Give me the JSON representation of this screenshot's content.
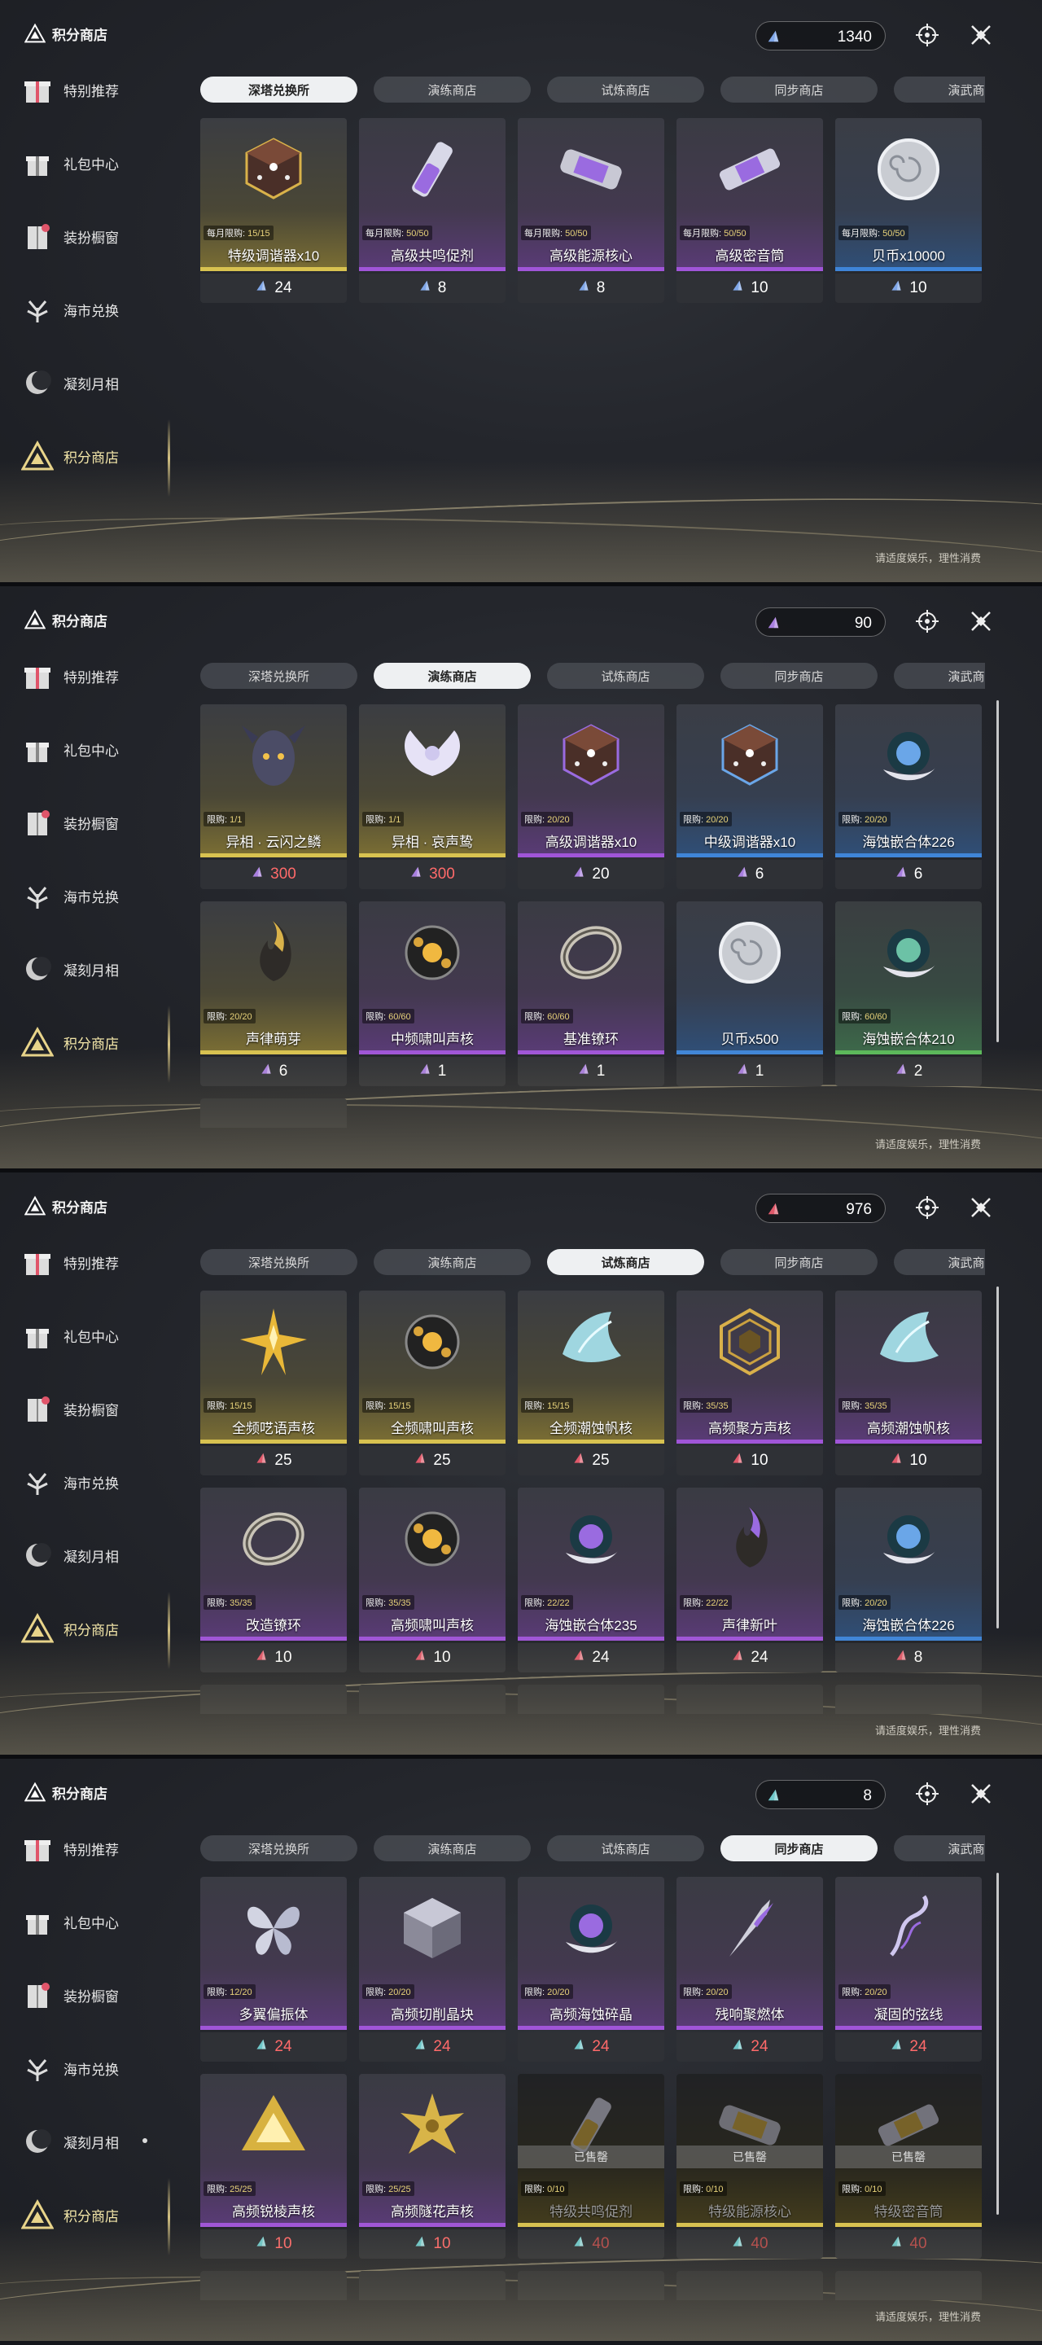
{
  "brand_title": "积分商店",
  "footnote": "请适度娱乐，理性消费",
  "sidebar": [
    {
      "label": "特别推荐",
      "icon": "gift-tag-icon"
    },
    {
      "label": "礼包中心",
      "icon": "gift-box-icon"
    },
    {
      "label": "装扮橱窗",
      "icon": "wardrobe-icon"
    },
    {
      "label": "海市兑换",
      "icon": "coral-tree-icon"
    },
    {
      "label": "凝刻月相",
      "icon": "moon-phase-icon"
    },
    {
      "label": "积分商店",
      "icon": "triangle-emblem-icon"
    }
  ],
  "tabs": [
    "深塔兑换所",
    "演练商店",
    "试炼商店",
    "同步商店",
    "演武商店"
  ],
  "panels": [
    {
      "active_tab": 0,
      "currency": {
        "value": "1340",
        "color": "#7fa6e8"
      },
      "items": [
        {
          "name": "特级调谐器x10",
          "limit_label": "每月限购:",
          "limit": "15/15",
          "price": "24",
          "rarity": "gold",
          "icon": "tuner-dice-icon"
        },
        {
          "name": "高级共鸣促剂",
          "limit_label": "每月限购:",
          "limit": "50/50",
          "price": "8",
          "rarity": "purple",
          "icon": "vial-icon"
        },
        {
          "name": "高级能源核心",
          "limit_label": "每月限购:",
          "limit": "50/50",
          "price": "8",
          "rarity": "purple",
          "icon": "energy-cell-icon"
        },
        {
          "name": "高级密音筒",
          "limit_label": "每月限购:",
          "limit": "50/50",
          "price": "10",
          "rarity": "purple",
          "icon": "sound-tube-icon"
        },
        {
          "name": "贝币x10000",
          "limit_label": "每月限购:",
          "limit": "50/50",
          "price": "10",
          "rarity": "blue",
          "icon": "shell-coin-icon"
        }
      ]
    },
    {
      "active_tab": 1,
      "currency": {
        "value": "90",
        "color": "#a97fe0"
      },
      "items": [
        {
          "name": "异相 · 云闪之鳞",
          "limit_label": "限购:",
          "limit": "1/1",
          "price": "300",
          "rarity": "gold",
          "icon": "dark-mask-icon",
          "red": true
        },
        {
          "name": "异相 · 哀声鸷",
          "limit_label": "限购:",
          "limit": "1/1",
          "price": "300",
          "rarity": "gold",
          "icon": "white-wings-icon",
          "red": true
        },
        {
          "name": "高级调谐器x10",
          "limit_label": "限购:",
          "limit": "20/20",
          "price": "20",
          "rarity": "purple",
          "icon": "tuner-dice-icon"
        },
        {
          "name": "中级调谐器x10",
          "limit_label": "限购:",
          "limit": "20/20",
          "price": "6",
          "rarity": "blue",
          "icon": "tuner-dice-icon"
        },
        {
          "name": "海蚀嵌合体226",
          "limit_label": "限购:",
          "limit": "20/20",
          "price": "6",
          "rarity": "blue",
          "icon": "orb-shell-icon"
        },
        {
          "name": "声律萌芽",
          "limit_label": "限购:",
          "limit": "20/20",
          "price": "6",
          "rarity": "gold",
          "icon": "flame-sprout-icon"
        },
        {
          "name": "中频啸叫声核",
          "limit_label": "限购:",
          "limit": "60/60",
          "price": "1",
          "rarity": "purple",
          "icon": "core-orb-icon"
        },
        {
          "name": "基准镣环",
          "limit_label": "限购:",
          "limit": "60/60",
          "price": "1",
          "rarity": "purple",
          "icon": "ring-icon"
        },
        {
          "name": "贝币x500",
          "limit_label": "",
          "limit": "",
          "price": "1",
          "rarity": "blue",
          "icon": "shell-coin-icon"
        },
        {
          "name": "海蚀嵌合体210",
          "limit_label": "限购:",
          "limit": "60/60",
          "price": "2",
          "rarity": "green",
          "icon": "orb-shell-icon"
        }
      ]
    },
    {
      "active_tab": 2,
      "currency": {
        "value": "976",
        "color": "#e0596a"
      },
      "items": [
        {
          "name": "全频呓语声核",
          "limit_label": "限购:",
          "limit": "15/15",
          "price": "25",
          "rarity": "gold",
          "icon": "star-burst-icon"
        },
        {
          "name": "全频啸叫声核",
          "limit_label": "限购:",
          "limit": "15/15",
          "price": "25",
          "rarity": "gold",
          "icon": "core-orb-icon"
        },
        {
          "name": "全频潮蚀帆核",
          "limit_label": "限购:",
          "limit": "15/15",
          "price": "25",
          "rarity": "gold",
          "icon": "crystal-sail-icon"
        },
        {
          "name": "高频聚方声核",
          "limit_label": "限购:",
          "limit": "35/35",
          "price": "10",
          "rarity": "purple",
          "icon": "hex-spiral-icon"
        },
        {
          "name": "高频潮蚀帆核",
          "limit_label": "限购:",
          "limit": "35/35",
          "price": "10",
          "rarity": "purple",
          "icon": "crystal-sail-icon"
        },
        {
          "name": "改造镣环",
          "limit_label": "限购:",
          "limit": "35/35",
          "price": "10",
          "rarity": "purple",
          "icon": "ring-icon"
        },
        {
          "name": "高频啸叫声核",
          "limit_label": "限购:",
          "limit": "35/35",
          "price": "10",
          "rarity": "purple",
          "icon": "core-orb-icon"
        },
        {
          "name": "海蚀嵌合体235",
          "limit_label": "限购:",
          "limit": "22/22",
          "price": "24",
          "rarity": "purple",
          "icon": "orb-shell-icon"
        },
        {
          "name": "声律新叶",
          "limit_label": "限购:",
          "limit": "22/22",
          "price": "24",
          "rarity": "purple",
          "icon": "flame-sprout-icon"
        },
        {
          "name": "海蚀嵌合体226",
          "limit_label": "限购:",
          "limit": "20/20",
          "price": "8",
          "rarity": "blue",
          "icon": "orb-shell-icon"
        }
      ]
    },
    {
      "active_tab": 3,
      "currency": {
        "value": "8",
        "color": "#6fc7c9"
      },
      "items": [
        {
          "name": "多翼偏振体",
          "limit_label": "限购:",
          "limit": "12/20",
          "price": "24",
          "rarity": "purple",
          "icon": "butterfly-icon",
          "red": true
        },
        {
          "name": "高频切削晶块",
          "limit_label": "限购:",
          "limit": "20/20",
          "price": "24",
          "rarity": "purple",
          "icon": "cube-icon",
          "red": true
        },
        {
          "name": "高频海蚀碎晶",
          "limit_label": "限购:",
          "limit": "20/20",
          "price": "24",
          "rarity": "purple",
          "icon": "orb-shell-icon",
          "red": true
        },
        {
          "name": "残响聚燃体",
          "limit_label": "限购:",
          "limit": "20/20",
          "price": "24",
          "rarity": "purple",
          "icon": "flare-icon",
          "red": true
        },
        {
          "name": "凝固的弦线",
          "limit_label": "限购:",
          "limit": "20/20",
          "price": "24",
          "rarity": "purple",
          "icon": "string-wisp-icon",
          "red": true
        },
        {
          "name": "高频锐棱声核",
          "limit_label": "限购:",
          "limit": "25/25",
          "price": "10",
          "rarity": "purple",
          "icon": "triangle-core-icon",
          "red": true
        },
        {
          "name": "高频隧花声核",
          "limit_label": "限购:",
          "limit": "25/25",
          "price": "10",
          "rarity": "purple",
          "icon": "flower-star-icon",
          "red": true
        },
        {
          "name": "特级共鸣促剂",
          "limit_label": "限购:",
          "limit": "0/10",
          "price": "40",
          "rarity": "gold",
          "icon": "vial-icon",
          "sold": true
        },
        {
          "name": "特级能源核心",
          "limit_label": "限购:",
          "limit": "0/10",
          "price": "40",
          "rarity": "gold",
          "icon": "energy-cell-icon",
          "sold": true
        },
        {
          "name": "特级密音筒",
          "limit_label": "限购:",
          "limit": "0/10",
          "price": "40",
          "rarity": "gold",
          "icon": "sound-tube-icon",
          "sold": true
        }
      ]
    }
  ],
  "sold_label": "已售罄",
  "rarity_colors": {
    "gold": "#d8c250",
    "purple": "#a055d8",
    "blue": "#3f85d8",
    "green": "#5bb85a"
  }
}
